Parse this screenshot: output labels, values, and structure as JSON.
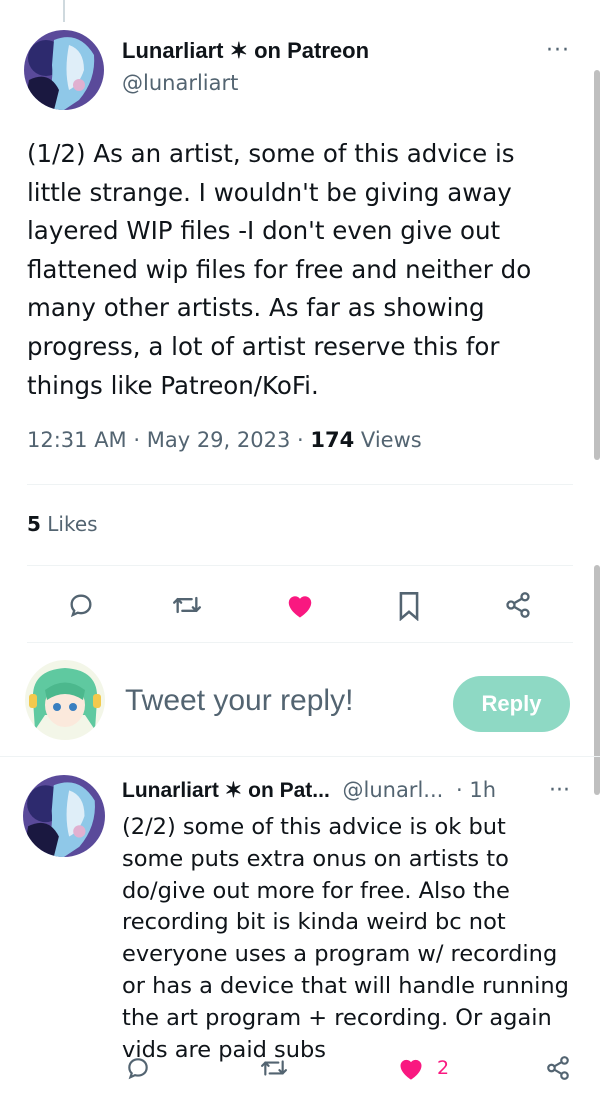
{
  "main_tweet": {
    "display_name": "Lunarliart ✶ on Patreon",
    "handle": "@lunarliart",
    "more": "···",
    "text": "(1/2) As an artist, some of this advice is little strange. I wouldn't be giving away layered WIP files -I don't even give out flattened wip files for free and neither do many other artists. As far as showing progress, a lot of artist reserve this for things like Patreon/KoFi.",
    "time": "12:31 AM",
    "date": "May 29, 2023",
    "views_count": "174",
    "views_label": "Views",
    "likes_count": "5",
    "likes_label": "Likes",
    "liked": true
  },
  "reply_box": {
    "placeholder": "Tweet your reply!",
    "button_label": "Reply"
  },
  "reply_tweet": {
    "display_name": "Lunarliart ✶ on Pat...",
    "handle": "@lunarl...",
    "age": "· 1h",
    "more": "···",
    "text": "(2/2) some of this advice is ok but some puts extra onus on artists to do/give out more for free. Also the recording bit is kinda weird bc not everyone uses a program w/ recording or has a device that will handle running the art program + recording. Or again vids are paid subs",
    "like_count": "2",
    "liked": true
  },
  "colors": {
    "like": "#f91880",
    "reply_button": "#8ed9c4",
    "icon": "#536471"
  }
}
